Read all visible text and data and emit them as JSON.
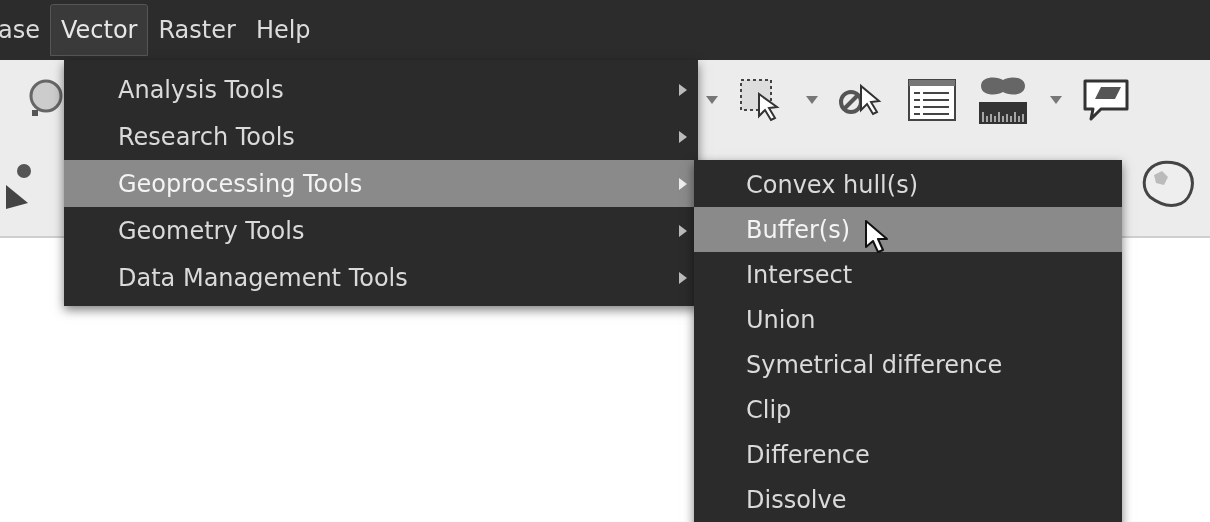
{
  "menubar": [
    {
      "label": "ase",
      "selected": false
    },
    {
      "label": "Vector",
      "selected": true
    },
    {
      "label": "Raster",
      "selected": false
    },
    {
      "label": "Help",
      "selected": false
    }
  ],
  "vector_menu": {
    "items": [
      {
        "label": "Analysis Tools",
        "selected": false
      },
      {
        "label": "Research Tools",
        "selected": false
      },
      {
        "label": "Geoprocessing Tools",
        "selected": true
      },
      {
        "label": "Geometry Tools",
        "selected": false
      },
      {
        "label": "Data Management Tools",
        "selected": false
      }
    ]
  },
  "geoprocessing_submenu": {
    "items": [
      {
        "label": "Convex hull(s)",
        "selected": false
      },
      {
        "label": "Buffer(s)",
        "selected": true
      },
      {
        "label": "Intersect",
        "selected": false
      },
      {
        "label": "Union",
        "selected": false
      },
      {
        "label": "Symetrical difference",
        "selected": false
      },
      {
        "label": "Clip",
        "selected": false
      },
      {
        "label": "Difference",
        "selected": false
      },
      {
        "label": "Dissolve",
        "selected": false
      }
    ]
  }
}
